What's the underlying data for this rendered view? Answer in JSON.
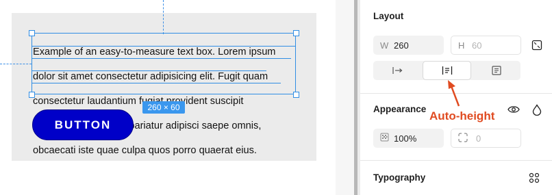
{
  "canvas": {
    "text_box": {
      "lines": [
        "Example of an easy-to-measure text box. Lorem ipsum",
        "dolor sit amet consectetur adipisicing elit. Fugit quam",
        "consectetur laudantium fugiat provident suscipit",
        "nostrum labore quasi pariatur adipisci saepe omnis,",
        "obcaecati iste quae culpa quos porro quaerat eius."
      ],
      "size_badge": "260 × 60"
    },
    "button_label": "BUTTON"
  },
  "panel": {
    "layout": {
      "title": "Layout",
      "width_label": "W",
      "width_value": "260",
      "height_label": "H",
      "height_value": "60",
      "resize_modes": [
        "auto-width",
        "auto-height",
        "fixed-size"
      ],
      "active_mode": "auto-height"
    },
    "appearance": {
      "title": "Appearance",
      "opacity": "100%",
      "corner_radius": "0"
    },
    "typography": {
      "title": "Typography"
    }
  },
  "annotation": {
    "label": "Auto-height",
    "color": "#e04b21"
  },
  "colors": {
    "selection": "#2f8de4",
    "button_bg": "#0000c8",
    "frame_bg": "#ebebeb"
  }
}
